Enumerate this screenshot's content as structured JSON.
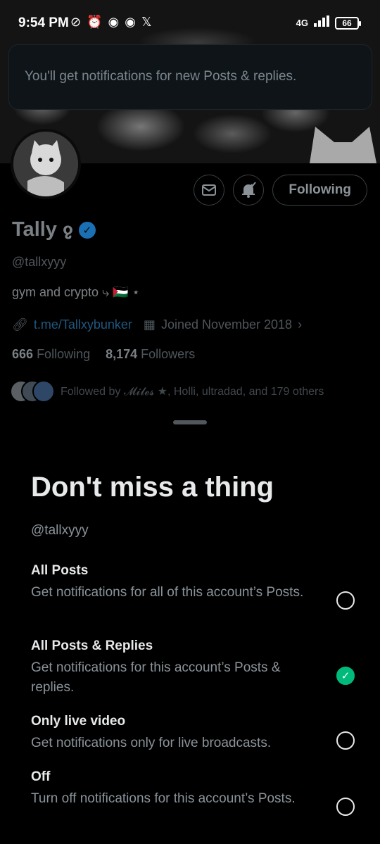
{
  "status_bar": {
    "time": "9:54 PM",
    "left_icons": [
      "mute-icon",
      "alarm-icon",
      "discord-icon",
      "discord-icon",
      "x-logo-icon"
    ],
    "left_glyphs": [
      "⊘",
      "⏰",
      "◉",
      "◉",
      "𝕏"
    ],
    "signal": "4G",
    "battery": "66"
  },
  "toast": {
    "text": "You'll get notifications for new Posts & replies."
  },
  "profile": {
    "name": "Tally",
    "name_emoji": "ჹ",
    "handle": "@tallxyyy",
    "bio": "gym and crypto ⤷ 🇵🇸 ⋆",
    "link": "t.me/Tallxybunker",
    "joined": "Joined November 2018",
    "following_count": "666",
    "following_label": "Following",
    "followers_count": "8,174",
    "followers_label": "Followers",
    "followed_by": "Followed by 𝓜𝓲𝓵𝓮𝓼 ★, Holli, ultradad, and 179 others",
    "follow_button": "Following"
  },
  "sheet": {
    "title": "Don't miss a thing",
    "handle": "@tallxyyy",
    "options": [
      {
        "title": "All Posts",
        "desc": "Get notifications for all of this account’s Posts.",
        "selected": false
      },
      {
        "title": "All Posts & Replies",
        "desc": "Get notifications for this account’s Posts & replies.",
        "selected": true
      },
      {
        "title": "Only live video",
        "desc": "Get notifications only for live broadcasts.",
        "selected": false
      },
      {
        "title": "Off",
        "desc": "Turn off notifications for this account’s Posts.",
        "selected": false
      }
    ]
  },
  "colors": {
    "accent_green": "#00ba7c",
    "verified_blue": "#1d9bf0",
    "background": "#000000"
  }
}
